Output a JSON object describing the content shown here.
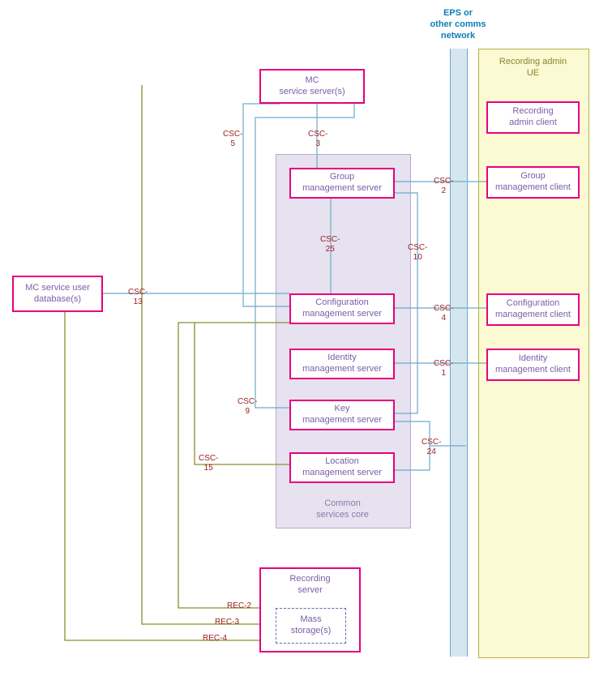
{
  "eps_label": "EPS or\nother comms\nnetwork",
  "ue_title": "Recording admin\nUE",
  "csc_title": "Common\nservices core",
  "nodes": {
    "mc_service_server": "MC\nservice server(s)",
    "group_mgmt_server": "Group\nmanagement server",
    "config_mgmt_server": "Configuration\nmanagement server",
    "identity_mgmt_server": "Identity\nmanagement server",
    "key_mgmt_server": "Key\nmanagement server",
    "location_mgmt_server": "Location\nmanagement server",
    "mc_user_db": "MC service user\ndatabase(s)",
    "recording_admin_client": "Recording\nadmin client",
    "group_mgmt_client": "Group\nmanagement client",
    "config_mgmt_client": "Configuration\nmanagement client",
    "identity_mgmt_client": "Identity\nmanagement client",
    "recording_server_title": "Recording\nserver",
    "mass_storage": "Mass\nstorage(s)"
  },
  "connectors": {
    "csc5": "CSC-\n5",
    "csc3": "CSC-\n3",
    "csc2": "CSC-\n2",
    "csc25": "CSC-\n25",
    "csc10": "CSC-\n10",
    "csc13": "CSC-\n13",
    "csc4": "CSC-\n4",
    "csc1": "CSC-\n1",
    "csc9": "CSC-\n9",
    "csc15": "CSC-\n15",
    "csc24": "CSC-\n24",
    "rec2": "REC-2",
    "rec3": "REC-3",
    "rec4": "REC-4"
  }
}
